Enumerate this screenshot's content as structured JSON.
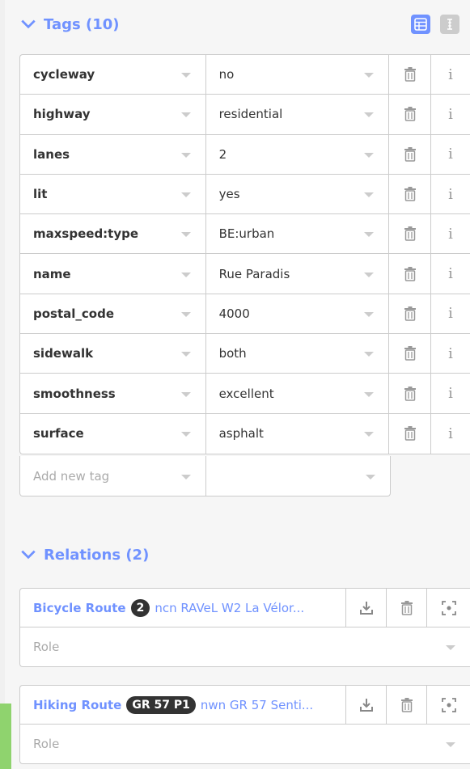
{
  "tags_section": {
    "title": "Tags (10)",
    "rows": [
      {
        "key": "cycleway",
        "value": "no"
      },
      {
        "key": "highway",
        "value": "residential"
      },
      {
        "key": "lanes",
        "value": "2"
      },
      {
        "key": "lit",
        "value": "yes"
      },
      {
        "key": "maxspeed:type",
        "value": "BE:urban"
      },
      {
        "key": "name",
        "value": "Rue Paradis"
      },
      {
        "key": "postal_code",
        "value": "4000"
      },
      {
        "key": "sidewalk",
        "value": "both"
      },
      {
        "key": "smoothness",
        "value": "excellent"
      },
      {
        "key": "surface",
        "value": "asphalt"
      }
    ],
    "new_tag_placeholder": "Add new tag",
    "info_glyph": "i",
    "icons": {
      "delete": "trash-icon",
      "info": "info-icon",
      "list_view": "list-view-icon",
      "text_view": "text-view-icon"
    }
  },
  "relations_section": {
    "title": "Relations (2)",
    "items": [
      {
        "type": "Bicycle Route",
        "badge": "2",
        "name": "ncn RAVeL W2 La Vélor...",
        "role_placeholder": "Role"
      },
      {
        "type": "Hiking Route",
        "badge": "GR 57 P1",
        "name": "nwn GR 57 Senti...",
        "role_placeholder": "Role"
      }
    ]
  },
  "colors": {
    "accent": "#7092ff",
    "border": "#cccccc",
    "badge_bg": "#333333",
    "green": "#8fd36e"
  }
}
